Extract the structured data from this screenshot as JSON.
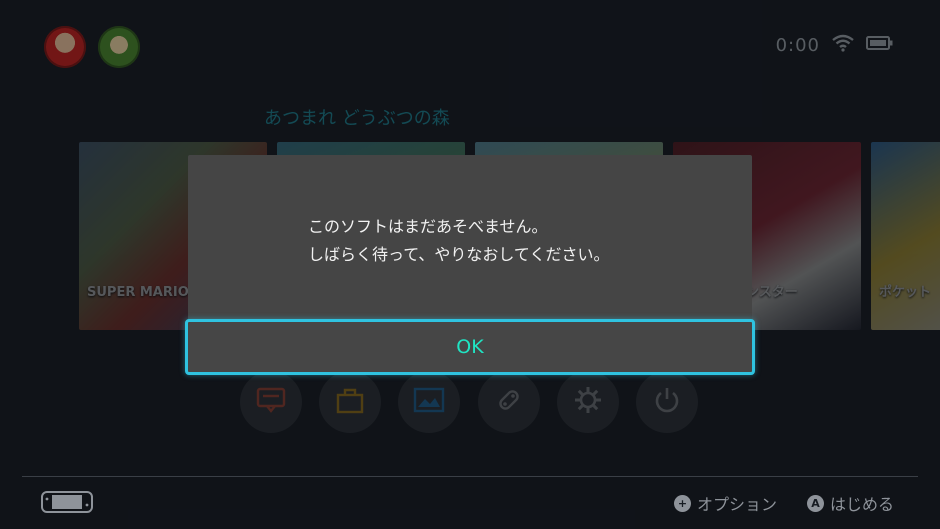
{
  "header": {
    "users": [
      {
        "name": "mario-avatar"
      },
      {
        "name": "link-avatar"
      }
    ],
    "time": "0:00",
    "icons": [
      "wifi-icon",
      "battery-icon"
    ]
  },
  "selected_game_title": "あつまれ どうぶつの森",
  "tiles": [
    {
      "label": "SUPER MARIO"
    },
    {
      "label": ""
    },
    {
      "label": ""
    },
    {
      "label": "ポケットモンスター"
    },
    {
      "label": "ポケット"
    }
  ],
  "dialog": {
    "line1": "このソフトはまだあそべません。",
    "line2": "しばらく待って、やりなおしてください。",
    "ok_label": "OK",
    "accent_color": "#2fc3e0",
    "ok_text_color": "#20e4c3"
  },
  "dock": [
    "news-icon",
    "eshop-icon",
    "album-icon",
    "controllers-icon",
    "settings-icon",
    "power-icon"
  ],
  "footer": {
    "options_label": "オプション",
    "start_label": "はじめる",
    "options_button": "+",
    "start_button": "A"
  }
}
